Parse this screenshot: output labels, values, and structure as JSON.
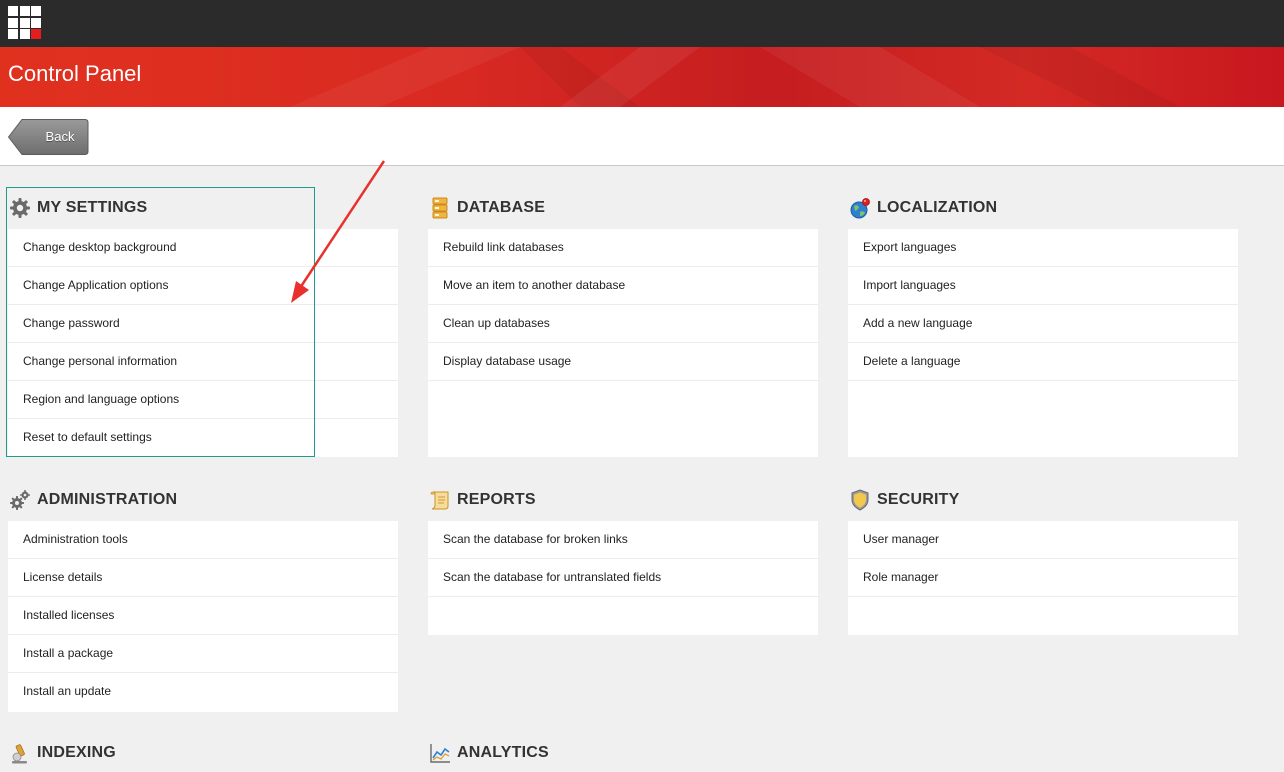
{
  "header": {
    "title": "Control Panel"
  },
  "toolbar": {
    "back_label": "Back"
  },
  "sections": {
    "my_settings": {
      "title": "MY SETTINGS",
      "items": [
        "Change desktop background",
        "Change Application options",
        "Change password",
        "Change personal information",
        "Region and language options",
        "Reset to default settings"
      ]
    },
    "database": {
      "title": "DATABASE",
      "items": [
        "Rebuild link databases",
        "Move an item to another database",
        "Clean up databases",
        "Display database usage"
      ]
    },
    "localization": {
      "title": "LOCALIZATION",
      "items": [
        "Export languages",
        "Import languages",
        "Add a new language",
        "Delete a language"
      ]
    },
    "administration": {
      "title": "ADMINISTRATION",
      "items": [
        "Administration tools",
        "License details",
        "Installed licenses",
        "Install a package",
        "Install an update"
      ]
    },
    "reports": {
      "title": "REPORTS",
      "items": [
        "Scan the database for broken links",
        "Scan the database for untranslated fields"
      ]
    },
    "security": {
      "title": "SECURITY",
      "items": [
        "User manager",
        "Role manager"
      ]
    },
    "indexing": {
      "title": "INDEXING"
    },
    "analytics": {
      "title": "ANALYTICS"
    }
  },
  "colors": {
    "topbar": "#2b2b2b",
    "banner_red": "#d42a24",
    "highlight": "#1e9a8e",
    "annotation_arrow": "#e8312c"
  },
  "icons": {
    "launcher": "app-grid-icon",
    "my_settings": "gear-icon",
    "database": "database-icon",
    "localization": "globe-icon",
    "administration": "gears-icon",
    "reports": "scroll-icon",
    "security": "shield-icon",
    "indexing": "microscope-icon",
    "analytics": "line-chart-icon"
  }
}
